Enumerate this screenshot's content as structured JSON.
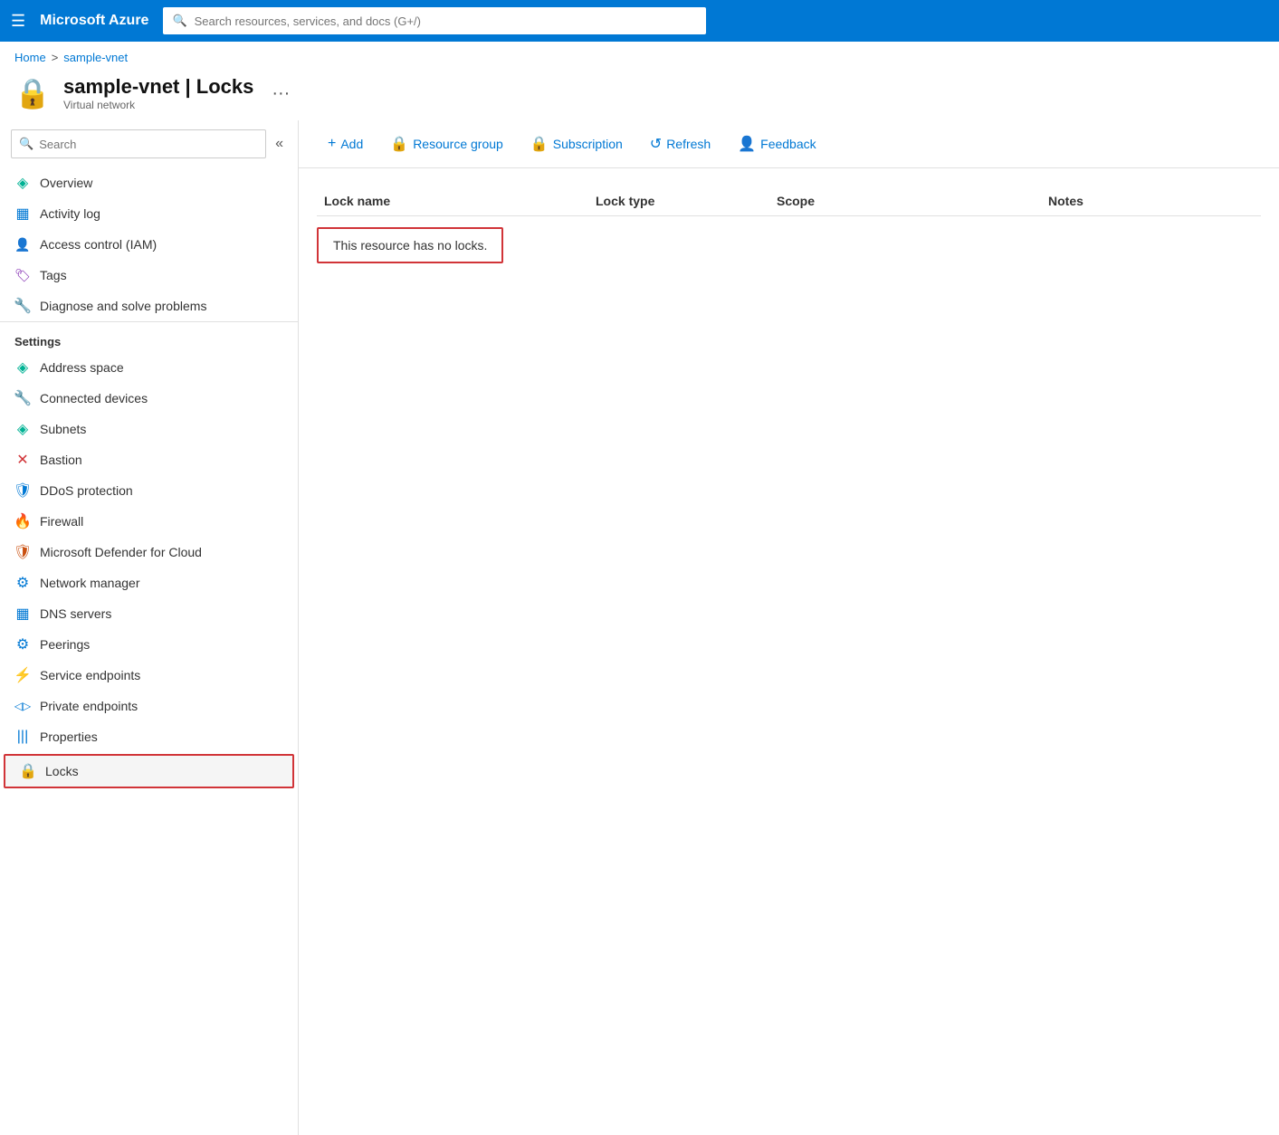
{
  "topbar": {
    "app_name": "Microsoft Azure",
    "search_placeholder": "Search resources, services, and docs (G+/)"
  },
  "breadcrumb": {
    "home": "Home",
    "separator": ">",
    "current": "sample-vnet"
  },
  "page_header": {
    "title": "sample-vnet | Locks",
    "subtitle": "Virtual network"
  },
  "toolbar": {
    "add_label": "Add",
    "resource_group_label": "Resource group",
    "subscription_label": "Subscription",
    "refresh_label": "Refresh",
    "feedback_label": "Feedback"
  },
  "sidebar": {
    "search_placeholder": "Search",
    "items": [
      {
        "id": "overview",
        "label": "Overview",
        "icon": "◈"
      },
      {
        "id": "activity-log",
        "label": "Activity log",
        "icon": "▦"
      },
      {
        "id": "access-control",
        "label": "Access control (IAM)",
        "icon": "👥"
      },
      {
        "id": "tags",
        "label": "Tags",
        "icon": "🏷"
      },
      {
        "id": "diagnose",
        "label": "Diagnose and solve problems",
        "icon": "🔧"
      }
    ],
    "settings_label": "Settings",
    "settings_items": [
      {
        "id": "address-space",
        "label": "Address space",
        "icon": "◈"
      },
      {
        "id": "connected-devices",
        "label": "Connected devices",
        "icon": "🔧"
      },
      {
        "id": "subnets",
        "label": "Subnets",
        "icon": "◈"
      },
      {
        "id": "bastion",
        "label": "Bastion",
        "icon": "✕"
      },
      {
        "id": "ddos-protection",
        "label": "DDoS protection",
        "icon": "🛡"
      },
      {
        "id": "firewall",
        "label": "Firewall",
        "icon": "🔥"
      },
      {
        "id": "ms-defender",
        "label": "Microsoft Defender for Cloud",
        "icon": "🛡"
      },
      {
        "id": "network-manager",
        "label": "Network manager",
        "icon": "⚙"
      },
      {
        "id": "dns-servers",
        "label": "DNS servers",
        "icon": "▦"
      },
      {
        "id": "peerings",
        "label": "Peerings",
        "icon": "⚙"
      },
      {
        "id": "service-endpoints",
        "label": "Service endpoints",
        "icon": "⚡"
      },
      {
        "id": "private-endpoints",
        "label": "Private endpoints",
        "icon": "◁▷"
      },
      {
        "id": "properties",
        "label": "Properties",
        "icon": "|||"
      },
      {
        "id": "locks",
        "label": "Locks",
        "icon": "🔒",
        "active": true
      }
    ]
  },
  "table": {
    "columns": [
      "Lock name",
      "Lock type",
      "Scope",
      "Notes"
    ],
    "empty_message": "This resource has no locks."
  }
}
